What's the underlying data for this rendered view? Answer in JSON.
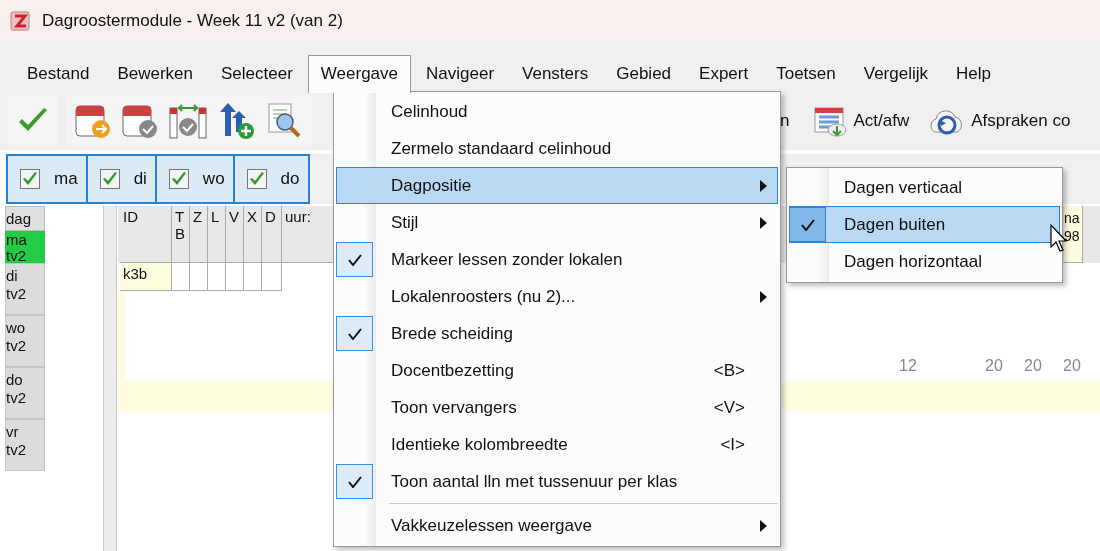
{
  "window": {
    "title": "Dagroostermodule - Week 11 v2 (van 2)"
  },
  "menu_bar": [
    {
      "label": "Bestand",
      "selected": false
    },
    {
      "label": "Bewerken",
      "selected": false
    },
    {
      "label": "Selecteer",
      "selected": false
    },
    {
      "label": "Weergave",
      "selected": true
    },
    {
      "label": "Navigeer",
      "selected": false
    },
    {
      "label": "Vensters",
      "selected": false
    },
    {
      "label": "Gebied",
      "selected": false
    },
    {
      "label": "Expert",
      "selected": false
    },
    {
      "label": "Toetsen",
      "selected": false
    },
    {
      "label": "Vergelijk",
      "selected": false
    },
    {
      "label": "Help",
      "selected": false
    }
  ],
  "toolbar": {
    "partial_label": "n",
    "buttons": [
      {
        "label": "Act/afw"
      },
      {
        "label": "Afspraken co"
      }
    ]
  },
  "day_tabs": [
    {
      "label": "ma",
      "checked": true
    },
    {
      "label": "di",
      "checked": true
    },
    {
      "label": "wo",
      "checked": true
    },
    {
      "label": "do",
      "checked": true
    }
  ],
  "day_list": {
    "header": "dag",
    "items": [
      {
        "label": "ma tv2",
        "selected": true
      },
      {
        "label": "di tv2",
        "selected": false
      },
      {
        "label": "wo tv2",
        "selected": false
      },
      {
        "label": "do tv2",
        "selected": false
      },
      {
        "label": "vr tv2",
        "selected": false
      }
    ]
  },
  "grid": {
    "columns": [
      "ID",
      "T B",
      "Z",
      "L",
      "V",
      "X",
      "D",
      "uur:"
    ],
    "first_cell": "k3b",
    "partial_header": "na 98",
    "totals": [
      "12",
      "20",
      "20",
      "20"
    ]
  },
  "menu": {
    "items": [
      {
        "kind": "item",
        "label": "Celinhoud",
        "checked": false,
        "selected": false,
        "submenu": false
      },
      {
        "kind": "item",
        "label": "Zermelo standaard celinhoud",
        "checked": false,
        "selected": false,
        "submenu": false
      },
      {
        "kind": "item",
        "label": "Dagpositie",
        "checked": false,
        "selected": true,
        "submenu": true
      },
      {
        "kind": "item",
        "label": "Stijl",
        "checked": false,
        "selected": false,
        "submenu": true
      },
      {
        "kind": "item",
        "label": "Markeer lessen zonder lokalen",
        "checked": true,
        "selected": false,
        "submenu": false
      },
      {
        "kind": "item",
        "label": "Lokalenroosters (nu 2)...",
        "checked": false,
        "selected": false,
        "submenu": true
      },
      {
        "kind": "item",
        "label": "Brede scheiding",
        "checked": true,
        "selected": false,
        "submenu": false
      },
      {
        "kind": "item",
        "label": "Docentbezetting",
        "shortcut": "<B>",
        "checked": false,
        "selected": false,
        "submenu": false
      },
      {
        "kind": "item",
        "label": "Toon vervangers",
        "shortcut": "<V>",
        "checked": false,
        "selected": false,
        "submenu": false
      },
      {
        "kind": "item",
        "label": "Identieke kolombreedte",
        "shortcut": "<I>",
        "checked": false,
        "selected": false,
        "submenu": false
      },
      {
        "kind": "item",
        "label": "Toon aantal lln met tussenuur per klas",
        "checked": true,
        "selected": false,
        "submenu": false
      },
      {
        "kind": "separator"
      },
      {
        "kind": "item",
        "label": "Vakkeuzelessen weergave",
        "checked": false,
        "selected": false,
        "submenu": true
      }
    ]
  },
  "submenu": {
    "items": [
      {
        "kind": "item",
        "label": "Dagen verticaal",
        "checked": false,
        "selected": false,
        "submenu": false
      },
      {
        "kind": "item",
        "label": "Dagen buiten",
        "checked": true,
        "selected": true,
        "submenu": false
      },
      {
        "kind": "item",
        "label": "Dagen horizontaal",
        "checked": false,
        "selected": false,
        "submenu": false
      }
    ]
  }
}
